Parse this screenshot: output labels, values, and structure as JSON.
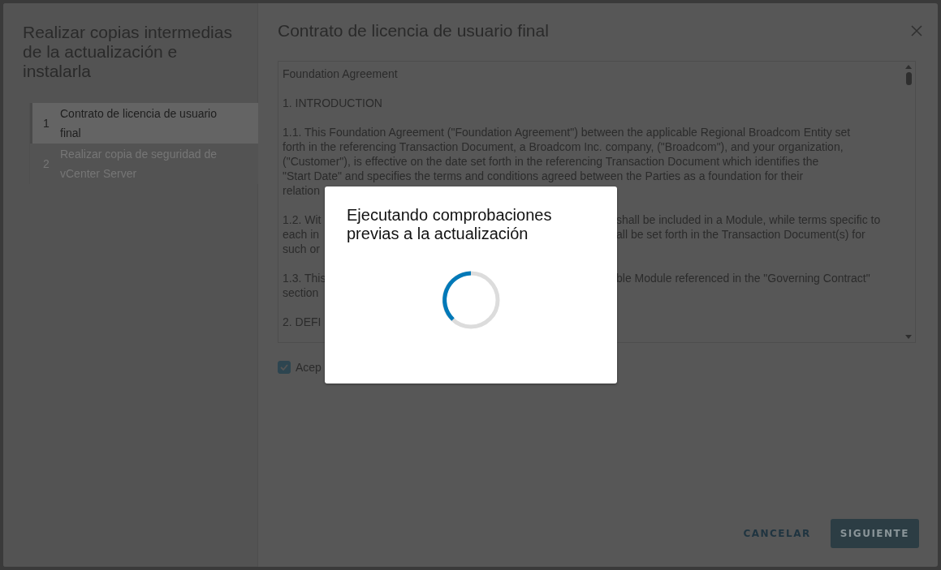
{
  "wizard": {
    "title": "Realizar copias intermedias de la actualización e instalarla",
    "steps": [
      {
        "number": "1",
        "label": "Contrato de licencia de usuario final",
        "selected": true,
        "disabled": false
      },
      {
        "number": "2",
        "label": "Realizar copia de seguridad de vCenter Server",
        "selected": false,
        "disabled": true
      }
    ]
  },
  "page": {
    "title": "Contrato de licencia de usuario final",
    "license_lines": [
      {
        "kind": "text",
        "text": "Foundation Agreement"
      },
      {
        "kind": "blank"
      },
      {
        "kind": "text",
        "text": "1. INTRODUCTION"
      },
      {
        "kind": "blank"
      },
      {
        "kind": "text",
        "text": "1.1. This Foundation Agreement (\"Foundation Agreement\") between the applicable Regional Broadcom Entity set"
      },
      {
        "kind": "text",
        "text": "forth in the referencing Transaction Document, a Broadcom Inc. company, (\"Broadcom\"), and your organization,"
      },
      {
        "kind": "text",
        "text": "(\"Customer\"), is effective on the date set forth in the referencing Transaction Document which identifies the"
      },
      {
        "kind": "text",
        "text": "\"Start Date\" and specifies the terms and conditions agreed between the Parties as a foundation for their"
      },
      {
        "kind": "text",
        "text": "relation"
      },
      {
        "kind": "blank"
      },
      {
        "kind": "split",
        "left": "1.2. Wit",
        "right": "shall be included in a Module, while terms specific to"
      },
      {
        "kind": "split",
        "left": "each in",
        "right": "all be set forth in the Transaction Document(s) for"
      },
      {
        "kind": "text",
        "text": "such or"
      },
      {
        "kind": "blank"
      },
      {
        "kind": "split",
        "left": "1.3. This",
        "right": "ble Module referenced in the \"Governing Contract\""
      },
      {
        "kind": "text",
        "text": "section"
      },
      {
        "kind": "blank"
      },
      {
        "kind": "text",
        "text": "2. DEFI"
      }
    ],
    "accept": {
      "label": "Acep",
      "checked": true
    },
    "buttons": [
      {
        "label": "CANCELAR",
        "kind": "flat"
      },
      {
        "label": "SIGUIENTE",
        "kind": "primary"
      }
    ]
  },
  "modal": {
    "title": "Ejecutando comprobaciones previas a la actualización"
  }
}
